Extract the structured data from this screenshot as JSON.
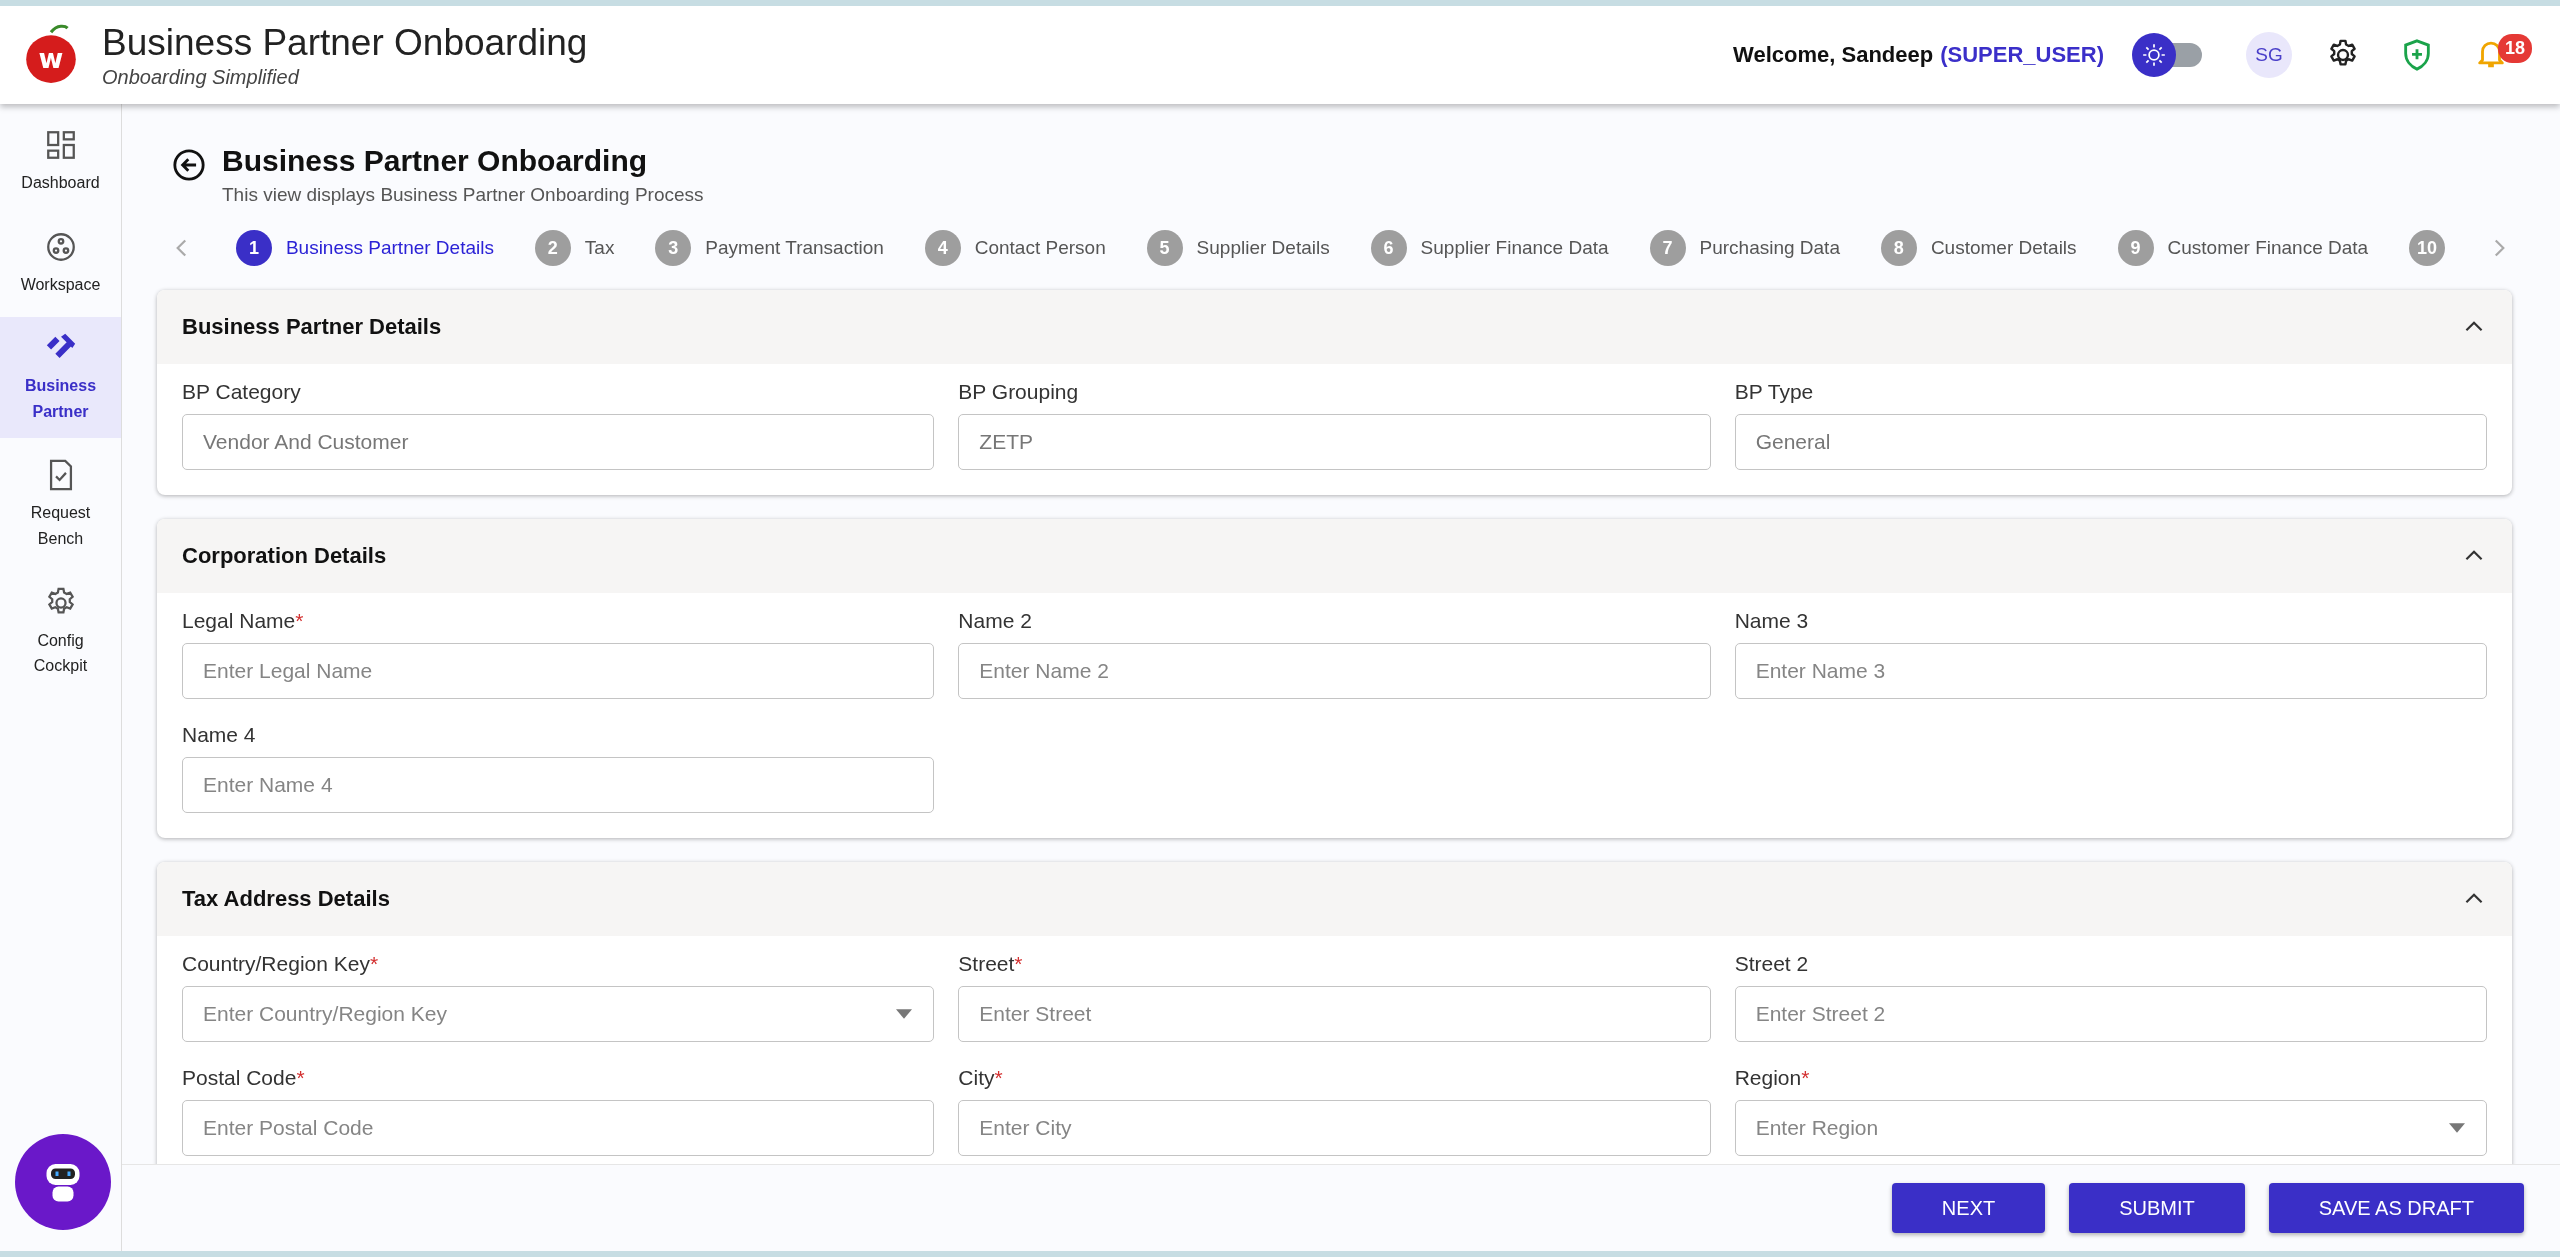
{
  "header": {
    "logo_letter": "w",
    "app_title": "Business Partner Onboarding",
    "app_subtitle": "Onboarding Simplified",
    "welcome": "Welcome, Sandeep",
    "role": "(SUPER_USER)",
    "theme_toggle": {
      "on": true
    },
    "avatar_initials": "SG",
    "notification_count": "18"
  },
  "sidebar": {
    "items": [
      {
        "label": "Dashboard",
        "selected": false
      },
      {
        "label": "Workspace",
        "selected": false
      },
      {
        "label": "Business Partner",
        "selected": true
      },
      {
        "label": "Request Bench",
        "selected": false
      },
      {
        "label": "Config Cockpit",
        "selected": false
      }
    ]
  },
  "page": {
    "title": "Business Partner Onboarding",
    "subtitle": "This view displays Business Partner Onboarding Process"
  },
  "steps": [
    {
      "number": "1",
      "label": "Business Partner Details",
      "selected": true
    },
    {
      "number": "2",
      "label": "Tax",
      "selected": false
    },
    {
      "number": "3",
      "label": "Payment Transaction",
      "selected": false
    },
    {
      "number": "4",
      "label": "Contact Person",
      "selected": false
    },
    {
      "number": "5",
      "label": "Supplier Details",
      "selected": false
    },
    {
      "number": "6",
      "label": "Supplier Finance Data",
      "selected": false
    },
    {
      "number": "7",
      "label": "Purchasing Data",
      "selected": false
    },
    {
      "number": "8",
      "label": "Customer Details",
      "selected": false
    },
    {
      "number": "9",
      "label": "Customer Finance Data",
      "selected": false
    },
    {
      "number": "10",
      "selected": false
    }
  ],
  "sections": [
    {
      "title": "Business Partner Details",
      "expanded": true,
      "fields": [
        {
          "label": "BP Category",
          "kind": "text",
          "value": "Vendor And Customer"
        },
        {
          "label": "BP Grouping",
          "kind": "text",
          "value": "ZETP"
        },
        {
          "label": "BP Type",
          "kind": "text",
          "value": "General"
        }
      ]
    },
    {
      "title": "Corporation Details",
      "expanded": true,
      "fields": [
        {
          "label": "Legal Name",
          "required_mark": "*",
          "kind": "text",
          "placeholder": "Enter Legal Name"
        },
        {
          "label": "Name 2",
          "kind": "text",
          "placeholder": "Enter Name 2"
        },
        {
          "label": "Name 3",
          "kind": "text",
          "placeholder": "Enter Name 3"
        },
        {
          "label": "Name 4",
          "kind": "text",
          "placeholder": "Enter Name 4"
        }
      ]
    },
    {
      "title": "Tax Address Details",
      "expanded": true,
      "fields": [
        {
          "label": "Country/Region Key",
          "required_mark": "*",
          "kind": "dropdown",
          "placeholder": "Enter Country/Region Key"
        },
        {
          "label": "Street",
          "required_mark": "*",
          "kind": "text",
          "placeholder": "Enter Street"
        },
        {
          "label": "Street 2",
          "kind": "text",
          "placeholder": "Enter Street 2"
        },
        {
          "label": "Postal Code",
          "required_mark": "*",
          "kind": "text",
          "placeholder": "Enter Postal Code"
        },
        {
          "label": "City",
          "required_mark": "*",
          "kind": "text",
          "placeholder": "Enter City"
        },
        {
          "label": "Region",
          "required_mark": "*",
          "kind": "dropdown",
          "placeholder": "Enter Region"
        }
      ]
    }
  ],
  "footer": {
    "buttons": [
      "NEXT",
      "SUBMIT",
      "SAVE AS DRAFT"
    ]
  }
}
